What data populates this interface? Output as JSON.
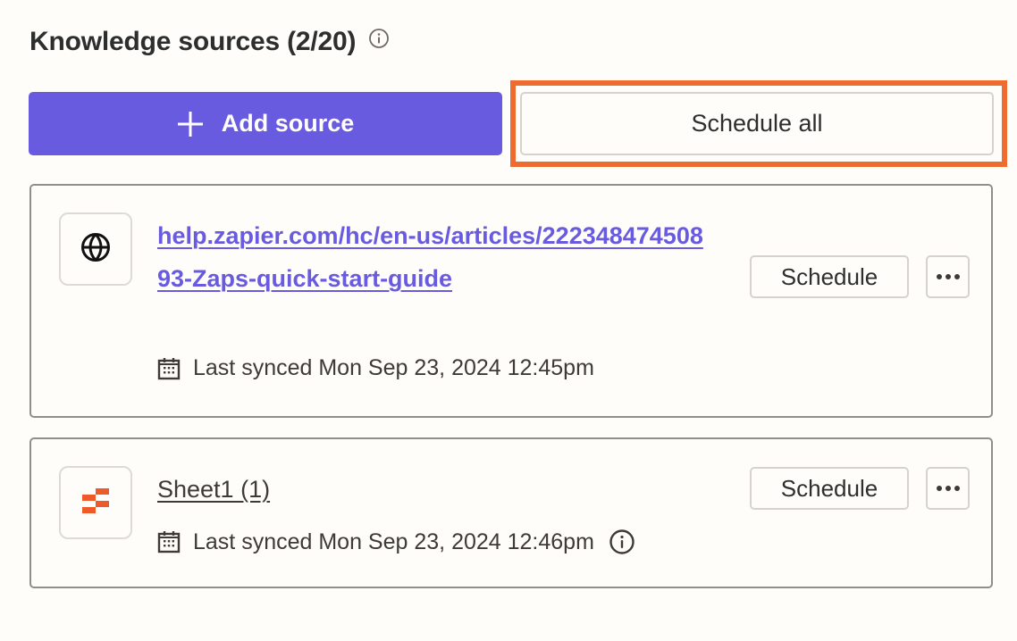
{
  "header": {
    "title": "Knowledge sources (2/20)",
    "info_icon": "info-circle-icon"
  },
  "actions": {
    "add_source_label": "Add source",
    "add_source_icon": "plus-icon",
    "schedule_all_label": "Schedule all",
    "highlighted": "schedule-all-button"
  },
  "sources": [
    {
      "type_icon": "globe-icon",
      "title": "help.zapier.com/hc/en-us/articles/22234847450893-Zaps-quick-start-guide",
      "sync_icon": "calendar-icon",
      "last_synced": "Last synced Mon Sep 23, 2024 12:45pm",
      "schedule_label": "Schedule",
      "more_icon": "more-horizontal-icon"
    },
    {
      "type_icon": "zapier-tables-icon",
      "title": "Sheet1 (1)",
      "sync_icon": "calendar-icon",
      "last_synced": "Last synced Mon Sep 23, 2024 12:46pm",
      "status_icon": "info-circle-icon",
      "schedule_label": "Schedule",
      "more_icon": "more-horizontal-icon"
    }
  ],
  "colors": {
    "background": "#fffdf9",
    "primary": "#695be0",
    "highlight": "#ee6c2e",
    "text": "#2d2e2e",
    "card_border": "#8f8f8c",
    "button_border": "#d5d3cb"
  }
}
